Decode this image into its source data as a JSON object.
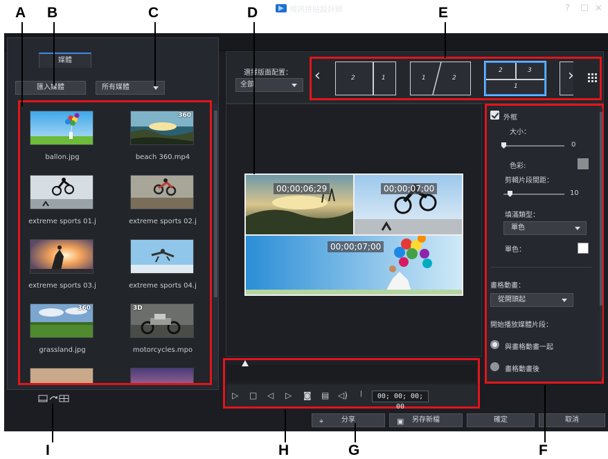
{
  "callouts": {
    "A": "A",
    "B": "B",
    "C": "C",
    "D": "D",
    "E": "E",
    "F": "F",
    "G": "G",
    "H": "H",
    "I": "I"
  },
  "window": {
    "title": "視訊拼貼設計師",
    "help": "?",
    "maximize": "☐",
    "close": "✕"
  },
  "media_panel": {
    "tab": "媒體",
    "import_button": "匯入媒體",
    "filter_select": "所有媒體",
    "items": [
      {
        "label": "ballon.jpg",
        "badge": ""
      },
      {
        "label": "beach 360.mp4",
        "badge": "360"
      },
      {
        "label": "extreme sports 01.j",
        "badge": ""
      },
      {
        "label": "extreme sports 02.j",
        "badge": ""
      },
      {
        "label": "extreme sports 03.j",
        "badge": ""
      },
      {
        "label": "extreme sports 04.j",
        "badge": ""
      },
      {
        "label": "grassland.jpg",
        "badge": "360"
      },
      {
        "label": "motorcycles.mpo",
        "badge": "3D"
      }
    ]
  },
  "layout_picker": {
    "label": "選擇版面配置：",
    "select": "全部",
    "templates": [
      {
        "cells": [
          "2",
          "1"
        ]
      },
      {
        "cells": [
          "1",
          "2"
        ]
      },
      {
        "cells": [
          "2",
          "3",
          "1"
        ],
        "selected": true
      }
    ]
  },
  "preview": {
    "timecodes": [
      "00;00;06;29",
      "00;00;07;00",
      "00;00;07;00"
    ]
  },
  "playback": {
    "timecode": "00; 00; 00; 00"
  },
  "settings": {
    "border_label": "外框",
    "size_label": "大小：",
    "size_value": "0",
    "color_label": "色彩:",
    "color_value": "#8a8c90",
    "spacing_label": "剪輯片段間距：",
    "spacing_value": "10",
    "fill_type_label": "填滿類型：",
    "fill_type_value": "單色",
    "solid_color_label": "單色：",
    "solid_color_value": "#ffffff",
    "frame_animation_label": "畫格動畫：",
    "frame_animation_value": "從開頭起",
    "start_playback_label": "開始播放媒體片段：",
    "option_with_animation": "與畫格動畫一起",
    "option_after_animation": "畫格動畫後"
  },
  "footer": {
    "share": "分享",
    "save_as": "另存新檔",
    "ok": "確定",
    "cancel": "取消"
  }
}
